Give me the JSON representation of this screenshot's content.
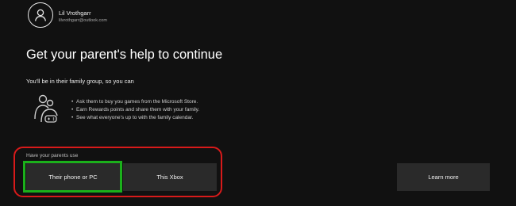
{
  "account": {
    "name": "Lil Vrothgarr",
    "email": "lilvrothgarr@outlook.com",
    "avatar_icon": "person-outline-icon"
  },
  "title": "Get your parent's help to continue",
  "subtitle": "You'll be in their family group, so you can",
  "family_icon": "family-group-icon",
  "benefits": [
    "Ask them to buy you games from the Microsoft Store.",
    "Earn Rewards points and share them with your family.",
    "See what everyone's up to with the family calendar."
  ],
  "options": {
    "label": "Have your parents use",
    "phone_button": "Their phone or PC",
    "xbox_button": "This Xbox"
  },
  "learn_more": "Learn more",
  "highlight_colors": {
    "group": "#d81a1a",
    "selected": "#1bb01b"
  }
}
